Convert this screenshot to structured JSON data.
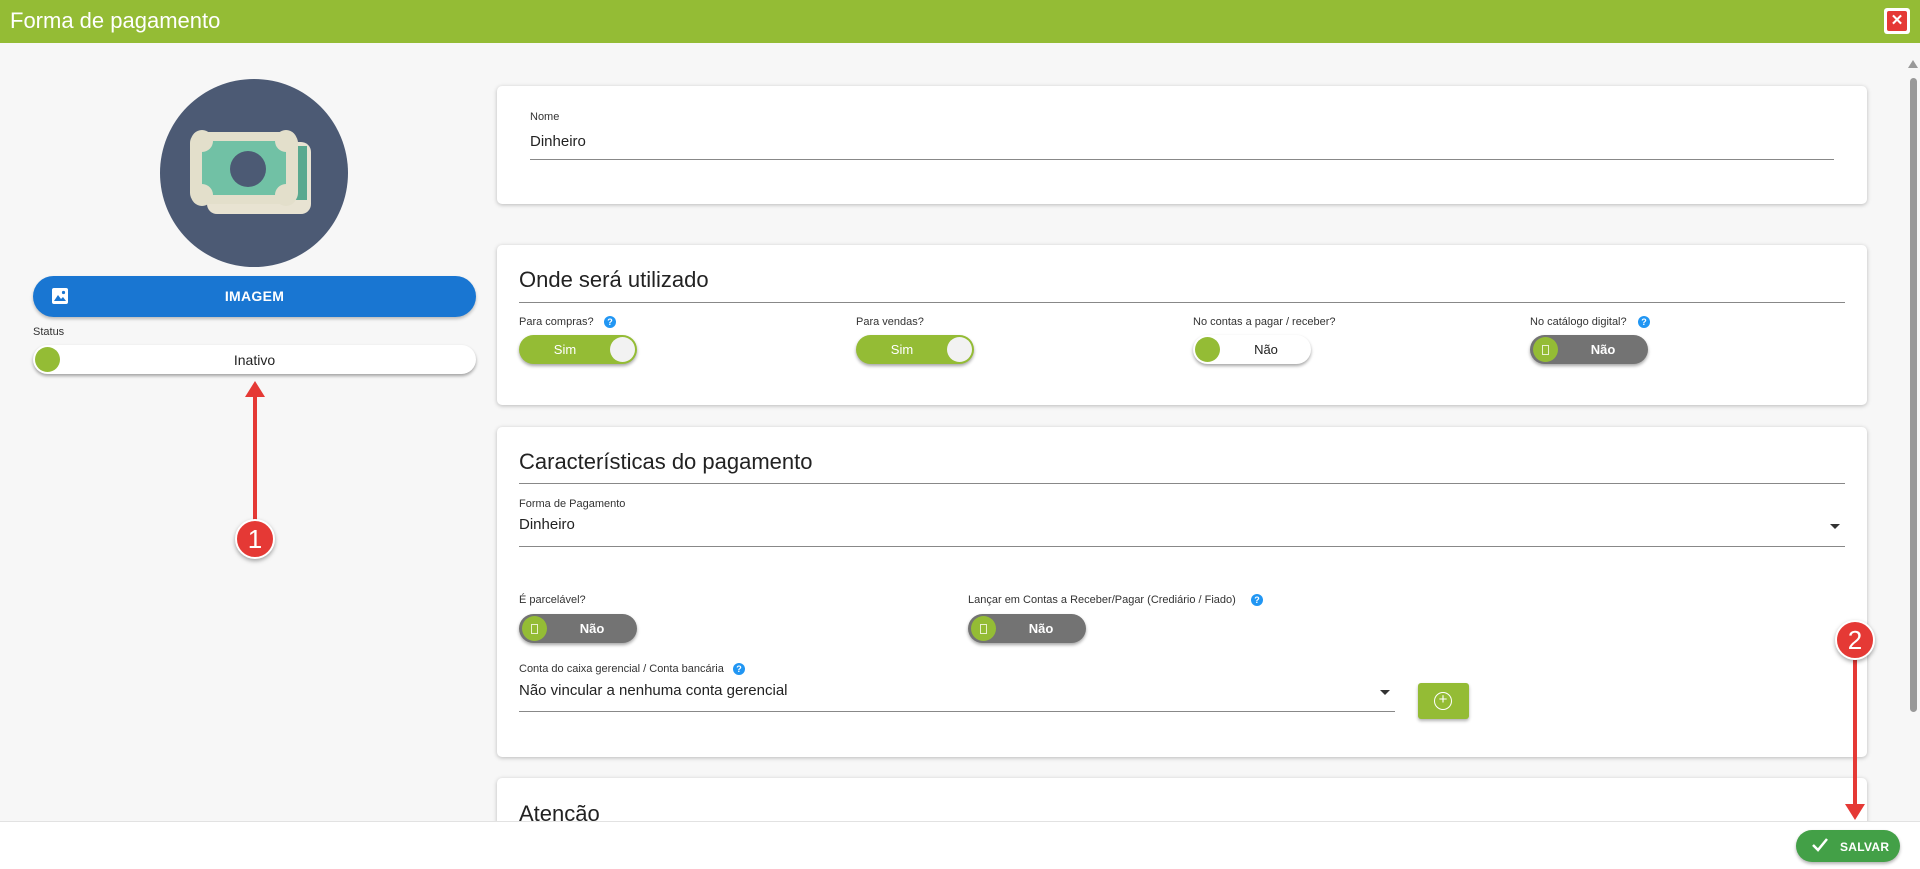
{
  "window": {
    "title": "Forma de pagamento",
    "close_icon": "close-icon",
    "accent": "#94bc35"
  },
  "sidebar": {
    "image_button": {
      "label": "IMAGEM",
      "icon": "image-icon"
    },
    "status": {
      "label": "Status",
      "value": "Inativo",
      "active": false
    }
  },
  "nome": {
    "label": "Nome",
    "value": "Dinheiro"
  },
  "onde": {
    "title": "Onde será utilizado",
    "toggles": [
      {
        "label": "Para compras?",
        "value": "Sim",
        "on": true,
        "help": true
      },
      {
        "label": "Para vendas?",
        "value": "Sim",
        "on": true,
        "help": false
      },
      {
        "label": "No contas a pagar / receber?",
        "value": "Não",
        "on": false,
        "help": false
      },
      {
        "label": "No catálogo digital?",
        "value": "Não",
        "on": false,
        "help": true
      }
    ]
  },
  "caracteristicas": {
    "title": "Características do pagamento",
    "forma": {
      "label": "Forma de Pagamento",
      "value": "Dinheiro"
    },
    "parcelavel": {
      "label": "É parcelável?",
      "value": "Não",
      "on": false
    },
    "lancar": {
      "label": "Lançar em Contas a Receber/Pagar (Crediário / Fiado)",
      "value": "Não",
      "on": false
    },
    "conta": {
      "label": "Conta do caixa gerencial / Conta bancária",
      "value": "Não vincular a nenhuma conta gerencial"
    },
    "add_icon": "plus-circle-icon"
  },
  "atencao": {
    "title": "Atenção"
  },
  "footer": {
    "save_label": "SALVAR",
    "save_icon": "check-icon",
    "save_color": "#43a047"
  },
  "annotations": {
    "badge_1": "1",
    "badge_2": "2",
    "color": "#e53935"
  }
}
